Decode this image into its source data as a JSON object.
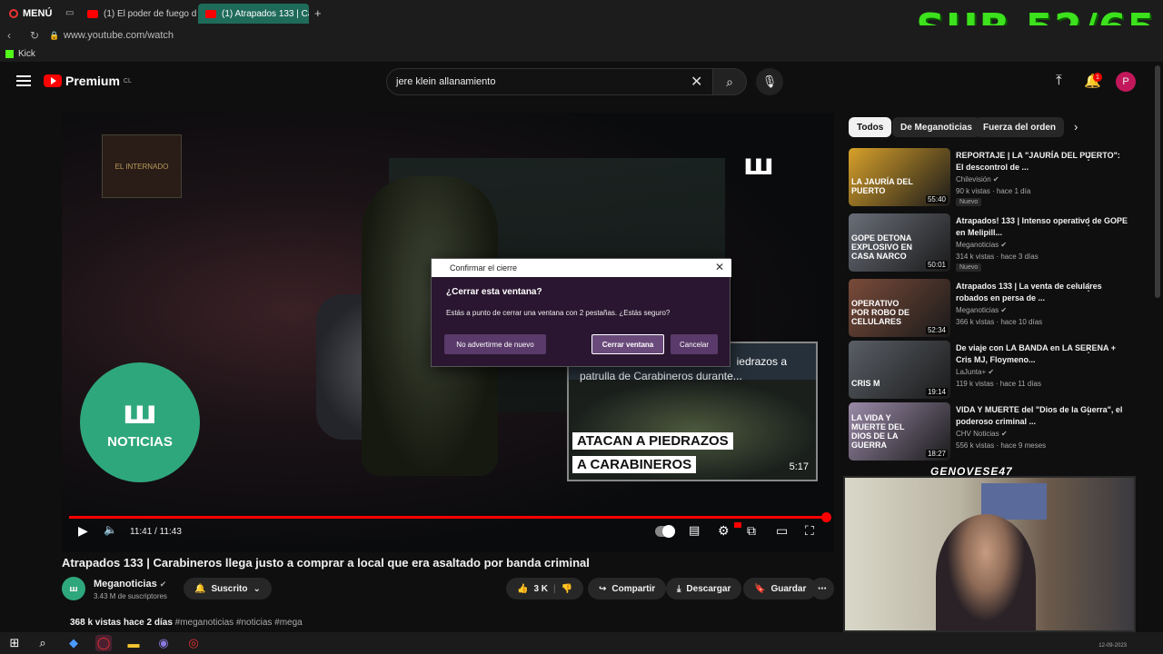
{
  "browser": {
    "menu_label": "MENÚ",
    "tabs": [
      {
        "label": "(1) El poder de fuego de l"
      },
      {
        "label": "(1) Atrapados 133 | Carab"
      }
    ],
    "new_tab": "+",
    "url": "www.youtube.com/watch",
    "bookmark": "Kick"
  },
  "overlay": {
    "sub_counter": "SUB 52/65",
    "streamer_name": "GENOVESE47",
    "clock": "12-09-2023"
  },
  "youtube": {
    "logo_text": "Premium",
    "logo_region": "CL",
    "search_value": "jere klein allanamiento",
    "notif_count": "1",
    "avatar_letter": "P"
  },
  "video": {
    "internado_text": "EL INTERNADO",
    "channel_bug": "NOTICIAS",
    "time": "11:41 / 11:43",
    "endcard": {
      "title": "Carabineros llega justo a comprar a local que era asaltado... iedrazos a patrulla de Carabineros durante...",
      "title_line1": "iedrazos a",
      "title_line2": "patrulla de Carabineros durante...",
      "caption1": "ATACAN A PIEDRAZOS",
      "caption2": "A CARABINEROS",
      "duration": "5:17"
    },
    "title": "Atrapados 133 | Carabineros llega justo a comprar a local que era asaltado por banda criminal",
    "channel": "Meganoticias",
    "subscribers": "3.43 M de suscriptores",
    "subscribed_label": "Suscrito",
    "likes": "3 K",
    "share_label": "Compartir",
    "download_label": "Descargar",
    "save_label": "Guardar",
    "views": "368 k vistas",
    "date": "hace 2 días",
    "tags": "#meganoticias #noticias #mega"
  },
  "dialog": {
    "title": "Confirmar el cierre",
    "question": "¿Cerrar esta ventana?",
    "message": "Estás a punto de cerrar una ventana con 2 pestañas. ¿Estás seguro?",
    "btn_no_warn": "No advertirme de nuevo",
    "btn_close": "Cerrar ventana",
    "btn_cancel": "Cancelar"
  },
  "sidebar": {
    "chips": [
      "Todos",
      "De Meganoticias",
      "Fuerza del orden"
    ],
    "recommendations": [
      {
        "title": "REPORTAJE | LA \"JAURÍA DEL PUERTO\": El descontrol de ...",
        "channel": "Chilevisión",
        "views": "90 k vistas · hace 1 día",
        "badge": "Nuevo",
        "duration": "55:40",
        "thumb_text": "LA JAURÍA DEL PUERTO",
        "color": "#d8a12a"
      },
      {
        "title": "Atrapados! 133 | Intenso operativo de GOPE en Melipill...",
        "channel": "Meganoticias",
        "views": "314 k vistas · hace 3 días",
        "badge": "Nuevo",
        "duration": "50:01",
        "thumb_text": "GOPE DETONA EXPLOSIVO EN CASA NARCO",
        "color": "#6a6e78"
      },
      {
        "title": "Atrapados 133 | La venta de celulares robados en persa de ...",
        "channel": "Meganoticias",
        "views": "366 k vistas · hace 10 días",
        "badge": "",
        "duration": "52:34",
        "thumb_text": "OPERATIVO POR ROBO DE CELULARES",
        "color": "#7a4b3a"
      },
      {
        "title": "De viaje con LA BANDA en LA SERENA + Cris MJ, Floymeno...",
        "channel": "LaJunta+",
        "views": "119 k vistas · hace 11 días",
        "badge": "",
        "duration": "19:14",
        "thumb_text": "CRIS M",
        "color": "#5a5f66"
      },
      {
        "title": "VIDA Y MUERTE del \"Dios de la Guerra\", el poderoso criminal ...",
        "channel": "CHV Noticias",
        "views": "556 k vistas · hace 9 meses",
        "badge": "",
        "duration": "18:27",
        "thumb_text": "LA VIDA Y MUERTE DEL DIOS DE LA GUERRA",
        "color": "#9a8aa8"
      }
    ]
  }
}
